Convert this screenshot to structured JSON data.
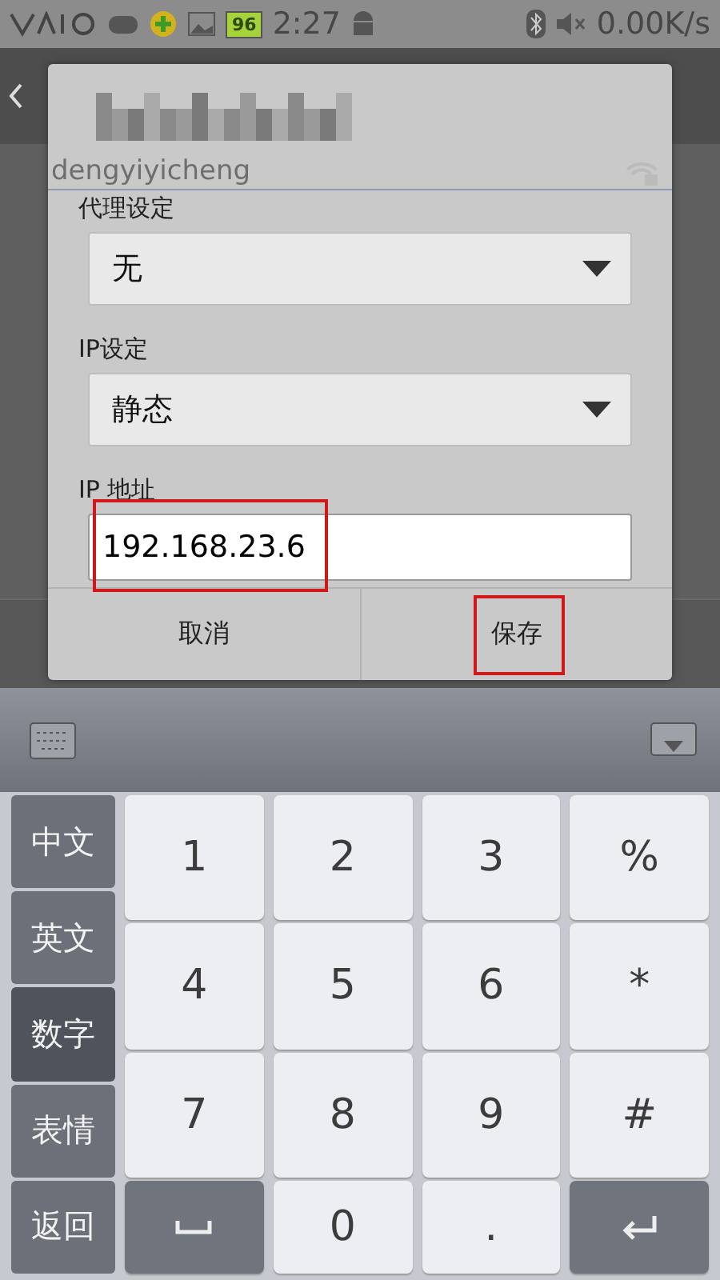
{
  "status_bar": {
    "battery": "96",
    "time": "2:27",
    "net_speed": "0.00K/s"
  },
  "background": {
    "network_name": "dengyiyicheng"
  },
  "dialog": {
    "fields": [
      {
        "kind": "dropdown",
        "label": "代理设定",
        "value": "无"
      },
      {
        "kind": "dropdown",
        "label": "IP设定",
        "value": "静态"
      },
      {
        "kind": "input",
        "label": "IP 地址",
        "value": "192.168.23.6",
        "highlighted": true
      }
    ],
    "buttons": [
      {
        "label": "取消",
        "highlighted": false
      },
      {
        "label": "保存",
        "highlighted": true
      }
    ]
  },
  "keyboard": {
    "side_keys": [
      {
        "label": "中文",
        "selected": false
      },
      {
        "label": "英文",
        "selected": false
      },
      {
        "label": "数字",
        "selected": true
      },
      {
        "label": "表情",
        "selected": false
      },
      {
        "label": "返回",
        "selected": false
      }
    ],
    "keys": [
      {
        "kind": "char",
        "label": "1"
      },
      {
        "kind": "char",
        "label": "2"
      },
      {
        "kind": "char",
        "label": "3"
      },
      {
        "kind": "char",
        "label": "%"
      },
      {
        "kind": "char",
        "label": "4"
      },
      {
        "kind": "char",
        "label": "5"
      },
      {
        "kind": "char",
        "label": "6"
      },
      {
        "kind": "char",
        "label": "*"
      },
      {
        "kind": "char",
        "label": "7"
      },
      {
        "kind": "char",
        "label": "8"
      },
      {
        "kind": "char",
        "label": "9"
      },
      {
        "kind": "char",
        "label": "#"
      },
      {
        "kind": "space"
      },
      {
        "kind": "char",
        "label": "0"
      },
      {
        "kind": "char",
        "label": "."
      },
      {
        "kind": "enter"
      }
    ]
  }
}
